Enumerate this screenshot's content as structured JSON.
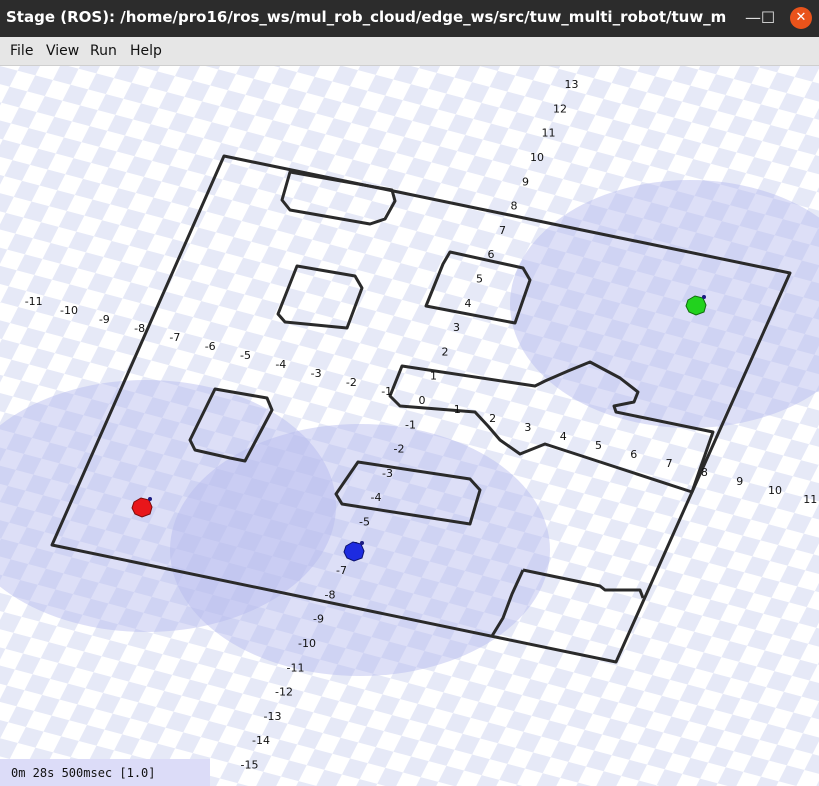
{
  "window": {
    "title": "Stage (ROS): /home/pro16/ros_ws/mul_rob_cloud/edge_ws/src/tuw_multi_robot/tuw_multi_robot_...",
    "min_glyph": "—",
    "max_glyph": "☐",
    "close_glyph": "✕"
  },
  "menu": {
    "file": "File",
    "view": "View",
    "run": "Run",
    "help": "Help"
  },
  "status": {
    "sim_time": "0m 28s 500msec [1.0]"
  },
  "axes": {
    "x_ticks": [
      "-11",
      "-10",
      "-9",
      "-8",
      "-7",
      "-6",
      "-5",
      "-4",
      "-3",
      "-2",
      "-1",
      "0",
      "1",
      "2",
      "3",
      "4",
      "5",
      "6",
      "7",
      "8",
      "9",
      "10",
      "11"
    ],
    "y_ticks": [
      "13",
      "12",
      "11",
      "10",
      "9",
      "8",
      "7",
      "6",
      "5",
      "4",
      "3",
      "2",
      "1",
      "-1",
      "-2",
      "-3",
      "-4",
      "-5",
      "-6",
      "-7",
      "-8",
      "-9",
      "-10",
      "-11",
      "-12",
      "-13",
      "-14",
      "-15"
    ]
  },
  "robots": [
    {
      "name": "red-robot",
      "color": "#e8161a"
    },
    {
      "name": "blue-robot",
      "color": "#1d2be0"
    },
    {
      "name": "green-robot",
      "color": "#22d21e"
    }
  ],
  "colors": {
    "floor_checker": "#e6e9f7",
    "sensor_range": "#b3b8ee",
    "walls": "#2a2a2a"
  }
}
